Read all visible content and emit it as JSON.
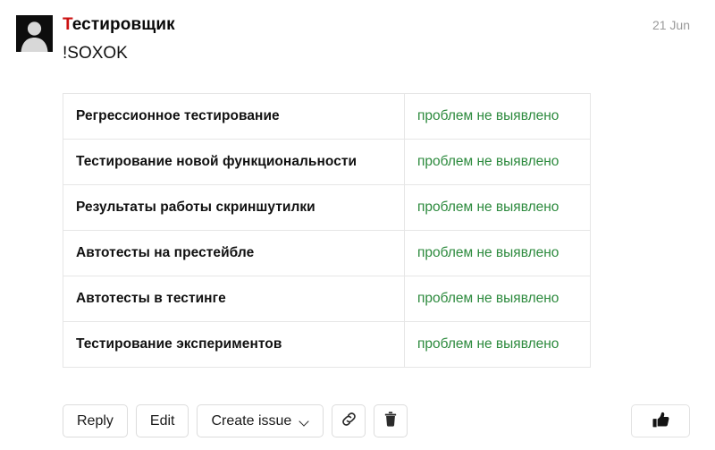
{
  "comment": {
    "author_initial": "Т",
    "author_rest": "естировщик",
    "author_full": "Тестировщик",
    "date": "21 Jun",
    "body_text": "!SOXOK",
    "avatar_icon": "user-avatar-icon"
  },
  "table": {
    "rows": [
      {
        "task": "Регрессионное тестирование",
        "status": "проблем не выявлено"
      },
      {
        "task": "Тестирование новой функциональности",
        "status": "проблем не выявлено"
      },
      {
        "task": "Результаты работы скриншутилки",
        "status": "проблем не выявлено"
      },
      {
        "task": "Автотесты на престейбле",
        "status": "проблем не выявлено"
      },
      {
        "task": "Автотесты в тестинге",
        "status": "проблем не выявлено"
      },
      {
        "task": "Тестирование экспериментов",
        "status": "проблем не выявлено"
      }
    ]
  },
  "toolbar": {
    "reply_label": "Reply",
    "edit_label": "Edit",
    "create_issue_label": "Create issue",
    "link_icon": "link-icon",
    "delete_icon": "trash-icon",
    "like_icon": "thumbs-up-icon"
  },
  "colors": {
    "status_green": "#2c8a3d",
    "author_initial_red": "#cc1111",
    "date_gray": "#9a9a9a",
    "table_border": "#e6e6e6",
    "button_border": "#dcdcdc"
  }
}
